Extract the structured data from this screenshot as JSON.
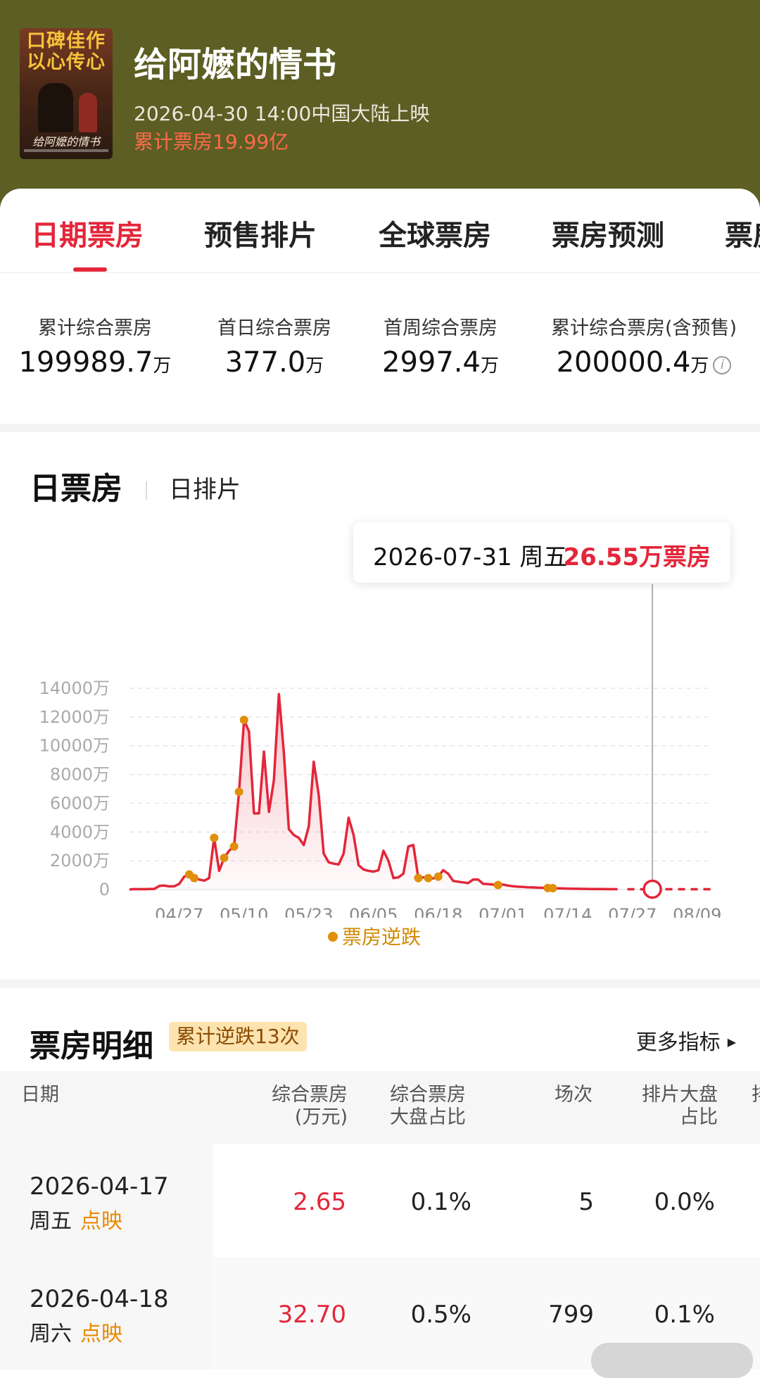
{
  "movie": {
    "title": "给阿嬷的情书",
    "release": "2026-04-30 14:00中国大陆上映",
    "total_box": "累计票房19.99亿",
    "poster_slogan_1": "口碑佳作",
    "poster_slogan_2": "以心传心",
    "poster_title": "给阿嬷的情书"
  },
  "tabs": [
    {
      "label": "日期票房",
      "active": true
    },
    {
      "label": "预售排片"
    },
    {
      "label": "全球票房"
    },
    {
      "label": "票房预测"
    },
    {
      "label": "票房"
    }
  ],
  "stats": [
    {
      "label": "累计综合票房",
      "value": "199989.7",
      "unit": "万"
    },
    {
      "label": "首日综合票房",
      "value": "377.0",
      "unit": "万"
    },
    {
      "label": "首周综合票房",
      "value": "2997.4",
      "unit": "万"
    },
    {
      "label": "累计综合票房(含预售)",
      "value": "200000.4",
      "unit": "万",
      "info_icon": "info-icon"
    }
  ],
  "chart_section": {
    "title": "日票房",
    "tab2": "日排片",
    "tooltip_date": "2026-07-31 周五",
    "tooltip_value": "26.55万票房",
    "legend": "票房逆跌"
  },
  "chart_data": {
    "type": "line",
    "yticks": [
      "14000万",
      "12000万",
      "10000万",
      "8000万",
      "6000万",
      "4000万",
      "2000万",
      "0"
    ],
    "ylim": [
      0,
      14000
    ],
    "xticks": [
      "04/27",
      "05/10",
      "05/23",
      "06/05",
      "06/18",
      "07/01",
      "07/14",
      "07/27",
      "08/09"
    ],
    "x_start": "2026-04-17",
    "series": [
      {
        "name": "日票房(万)",
        "values": [
          3,
          33,
          30,
          30,
          40,
          50,
          260,
          280,
          220,
          230,
          400,
          900,
          1050,
          800,
          700,
          620,
          800,
          3600,
          1300,
          2200,
          2700,
          3000,
          6800,
          11800,
          11000,
          5300,
          5300,
          9600,
          5400,
          7600,
          13600,
          9500,
          4200,
          3800,
          3600,
          3100,
          4400,
          8900,
          6600,
          2500,
          1900,
          1800,
          1750,
          2500,
          5000,
          3800,
          1700,
          1400,
          1300,
          1250,
          1350,
          2700,
          2000,
          800,
          850,
          1100,
          3000,
          3100,
          800,
          850,
          800,
          780,
          900,
          1350,
          1100,
          600,
          550,
          500,
          450,
          700,
          700,
          400,
          380,
          350,
          320,
          350,
          280,
          230,
          200,
          180,
          160,
          150,
          130,
          120,
          110,
          100,
          90,
          80,
          70,
          60,
          55,
          50,
          45,
          40,
          38,
          35,
          30,
          28,
          26.55
        ]
      }
    ],
    "highlight": {
      "date": "2026-07-31",
      "value": 26.55
    },
    "reversal_points": [
      {
        "date": "2026-04-29"
      },
      {
        "date": "2026-04-30"
      },
      {
        "date": "2026-05-04"
      },
      {
        "date": "2026-05-06"
      },
      {
        "date": "2026-05-08"
      },
      {
        "date": "2026-05-09"
      },
      {
        "date": "2026-05-10"
      },
      {
        "date": "2026-06-14"
      },
      {
        "date": "2026-06-16"
      },
      {
        "date": "2026-06-18"
      },
      {
        "date": "2026-06-30"
      },
      {
        "date": "2026-07-10"
      },
      {
        "date": "2026-07-11"
      }
    ]
  },
  "detail": {
    "title": "票房明细",
    "badge": "累计逆跌13次",
    "more": "更多指标",
    "headers": {
      "date": "日期",
      "box_1": "综合票房",
      "box_2": "(万元)",
      "share_1": "综合票房",
      "share_2": "大盘占比",
      "shows": "场次",
      "sched_1": "排片大盘",
      "sched_2": "占比",
      "extra": "排"
    },
    "rows": [
      {
        "date": "2026-04-17",
        "weekday": "周五",
        "tag": "点映",
        "box": "2.65",
        "share": "0.1%",
        "shows": "5",
        "sched": "0.0%"
      },
      {
        "date": "2026-04-18",
        "weekday": "周六",
        "tag": "点映",
        "box": "32.70",
        "share": "0.5%",
        "shows": "799",
        "sched": "0.1%"
      }
    ]
  },
  "colors": {
    "header_bg": "#5c5e23",
    "accent": "#e3263a",
    "reversal": "#e08f0b"
  }
}
